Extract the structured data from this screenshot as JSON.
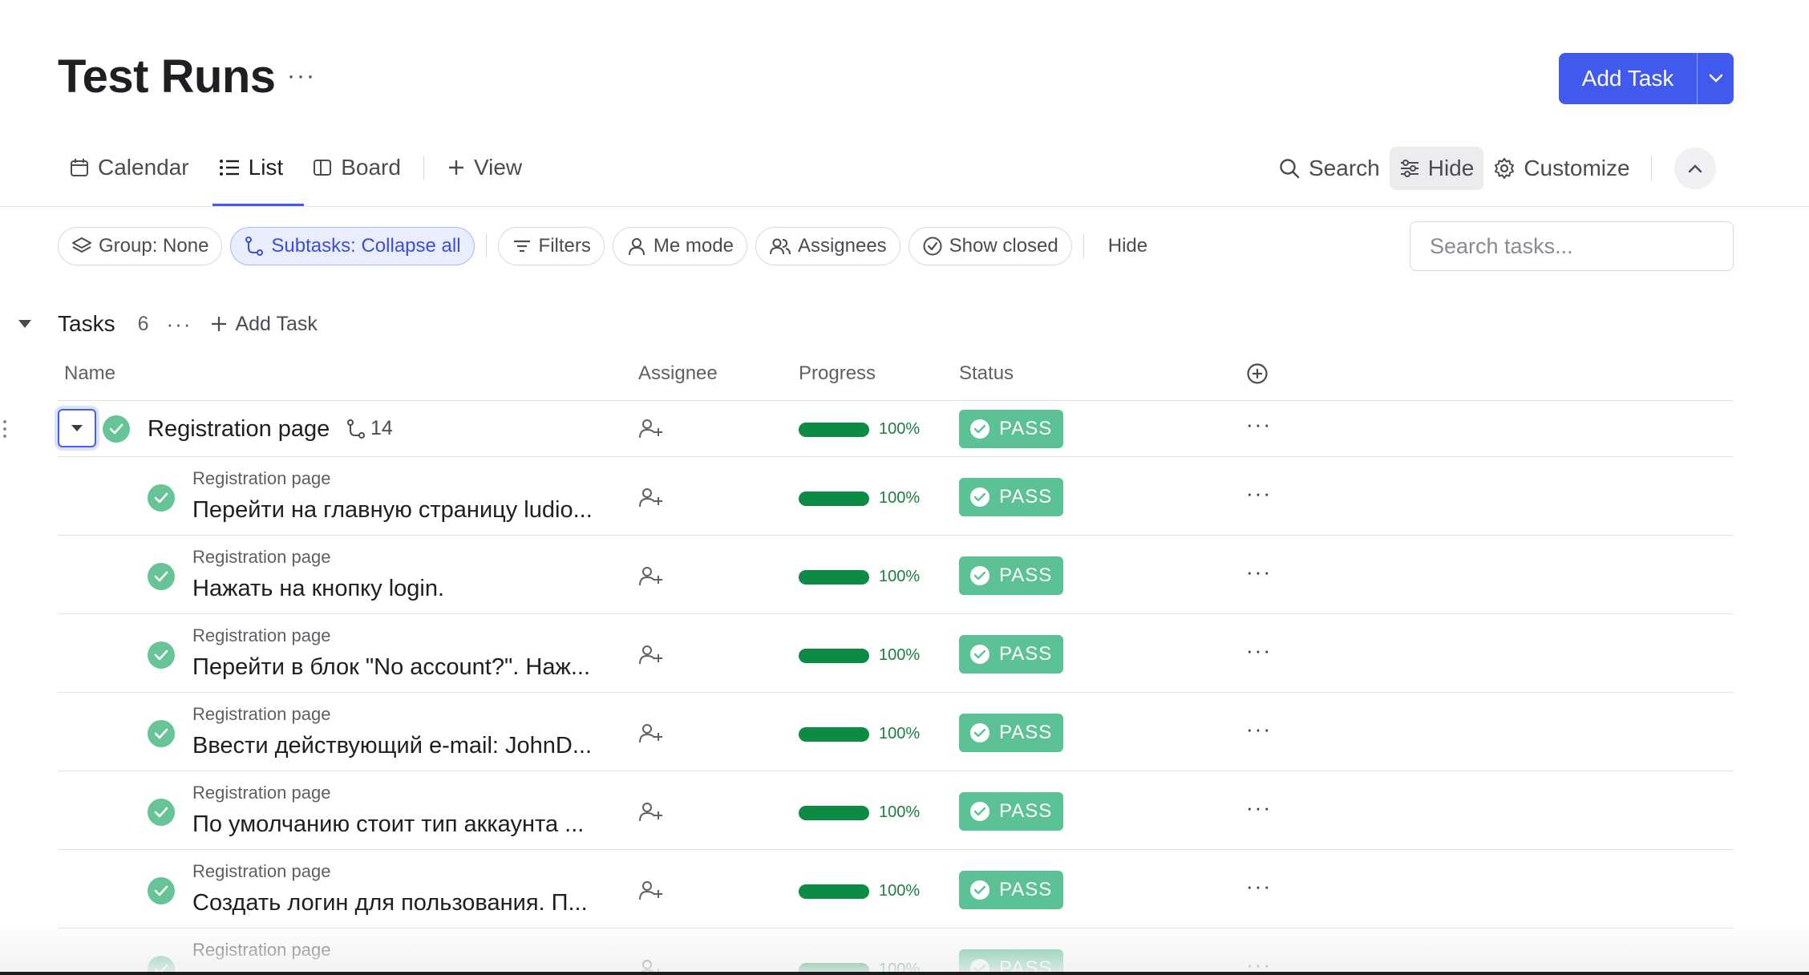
{
  "header": {
    "title": "Test Runs",
    "more": "···",
    "add_task_label": "Add Task"
  },
  "views": [
    {
      "label": "Calendar",
      "icon": "calendar-icon"
    },
    {
      "label": "List",
      "icon": "list-icon",
      "active": true
    },
    {
      "label": "Board",
      "icon": "board-icon"
    },
    {
      "label": "View",
      "icon": "plus-icon"
    }
  ],
  "tools": {
    "search": "Search",
    "hide": "Hide",
    "customize": "Customize"
  },
  "filters": {
    "group": "Group: None",
    "subtasks": "Subtasks: Collapse all",
    "filters": "Filters",
    "me_mode": "Me mode",
    "assignees": "Assignees",
    "show_closed": "Show closed",
    "hide": "Hide",
    "search_placeholder": "Search tasks..."
  },
  "group": {
    "title": "Tasks",
    "count": "6",
    "add_task": "Add Task"
  },
  "columns": {
    "name": "Name",
    "assignee": "Assignee",
    "progress": "Progress",
    "status": "Status"
  },
  "parent": {
    "title": "Registration page",
    "subtask_count": "14",
    "progress": "100%",
    "status": "PASS"
  },
  "subtasks": [
    {
      "crumb": "Registration page",
      "title": "Перейти на главную страницу ludio...",
      "progress": "100%",
      "status": "PASS"
    },
    {
      "crumb": "Registration page",
      "title": "Нажать на кнопку login.",
      "progress": "100%",
      "status": "PASS"
    },
    {
      "crumb": "Registration page",
      "title": "Перейти в блок \"No account?\". Наж...",
      "progress": "100%",
      "status": "PASS"
    },
    {
      "crumb": "Registration page",
      "title": "Ввести действующий e-mail: JohnD...",
      "progress": "100%",
      "status": "PASS"
    },
    {
      "crumb": "Registration page",
      "title": "По умолчанию стоит тип аккаунта ...",
      "progress": "100%",
      "status": "PASS"
    },
    {
      "crumb": "Registration page",
      "title": "Создать логин для пользования. П...",
      "progress": "100%",
      "status": "PASS"
    },
    {
      "crumb": "Registration page",
      "title": "",
      "progress": "100%",
      "status": "PASS"
    }
  ],
  "colors": {
    "accent": "#4259ee",
    "pass": "#5cc295",
    "progress": "#0d8a43"
  }
}
